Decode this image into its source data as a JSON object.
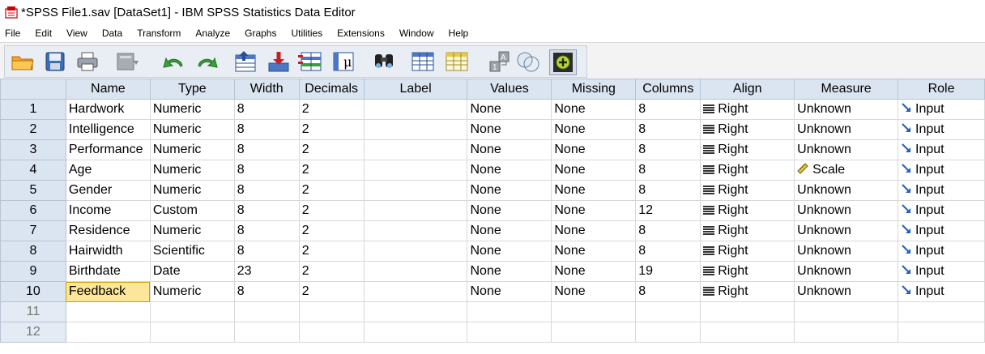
{
  "window": {
    "title": "*SPSS File1.sav [DataSet1] - IBM SPSS Statistics Data Editor"
  },
  "menu": [
    "File",
    "Edit",
    "View",
    "Data",
    "Transform",
    "Analyze",
    "Graphs",
    "Utilities",
    "Extensions",
    "Window",
    "Help"
  ],
  "columns": [
    "Name",
    "Type",
    "Width",
    "Decimals",
    "Label",
    "Values",
    "Missing",
    "Columns",
    "Align",
    "Measure",
    "Role"
  ],
  "rows": [
    {
      "num": "1",
      "name": "Hardwork",
      "type": "Numeric",
      "width": "8",
      "decimals": "2",
      "label": "",
      "values": "None",
      "missing": "None",
      "columns": "8",
      "align": "Right",
      "measure": "Unknown",
      "role": "Input"
    },
    {
      "num": "2",
      "name": "Intelligence",
      "type": "Numeric",
      "width": "8",
      "decimals": "2",
      "label": "",
      "values": "None",
      "missing": "None",
      "columns": "8",
      "align": "Right",
      "measure": "Unknown",
      "role": "Input"
    },
    {
      "num": "3",
      "name": "Performance",
      "type": "Numeric",
      "width": "8",
      "decimals": "2",
      "label": "",
      "values": "None",
      "missing": "None",
      "columns": "8",
      "align": "Right",
      "measure": "Unknown",
      "role": "Input"
    },
    {
      "num": "4",
      "name": "Age",
      "type": "Numeric",
      "width": "8",
      "decimals": "2",
      "label": "",
      "values": "None",
      "missing": "None",
      "columns": "8",
      "align": "Right",
      "measure": "Scale",
      "role": "Input"
    },
    {
      "num": "5",
      "name": "Gender",
      "type": "Numeric",
      "width": "8",
      "decimals": "2",
      "label": "",
      "values": "None",
      "missing": "None",
      "columns": "8",
      "align": "Right",
      "measure": "Unknown",
      "role": "Input"
    },
    {
      "num": "6",
      "name": "Income",
      "type": "Custom",
      "width": "8",
      "decimals": "2",
      "label": "",
      "values": "None",
      "missing": "None",
      "columns": "12",
      "align": "Right",
      "measure": "Unknown",
      "role": "Input"
    },
    {
      "num": "7",
      "name": "Residence",
      "type": "Numeric",
      "width": "8",
      "decimals": "2",
      "label": "",
      "values": "None",
      "missing": "None",
      "columns": "8",
      "align": "Right",
      "measure": "Unknown",
      "role": "Input"
    },
    {
      "num": "8",
      "name": "Hairwidth",
      "type": "Scientific",
      "width": "8",
      "decimals": "2",
      "label": "",
      "values": "None",
      "missing": "None",
      "columns": "8",
      "align": "Right",
      "measure": "Unknown",
      "role": "Input"
    },
    {
      "num": "9",
      "name": "Birthdate",
      "type": "Date",
      "width": "23",
      "decimals": "2",
      "label": "",
      "values": "None",
      "missing": "None",
      "columns": "19",
      "align": "Right",
      "measure": "Unknown",
      "role": "Input"
    },
    {
      "num": "10",
      "name": "Feedback",
      "type": "Numeric",
      "width": "8",
      "decimals": "2",
      "label": "",
      "values": "None",
      "missing": "None",
      "columns": "8",
      "align": "Right",
      "measure": "Unknown",
      "role": "Input"
    }
  ],
  "empty_rows": [
    "11",
    "12"
  ],
  "selected_cell": {
    "row": "10",
    "column": "Name"
  },
  "toolbar_icons": [
    "open-folder-icon",
    "save-icon",
    "print-icon",
    "dialog-recall-icon",
    "undo-icon",
    "redo-icon",
    "goto-case-icon",
    "goto-variable-icon",
    "variables-icon",
    "find-icon",
    "split-file-icon",
    "select-cases-icon",
    "weight-cases-icon",
    "value-labels-icon",
    "use-variable-sets-icon",
    "spelling-icon"
  ],
  "colors": {
    "header_bg": "#dbe5f1",
    "selected_cell": "#fde699",
    "toolbar_bg": "#e9eef5"
  }
}
